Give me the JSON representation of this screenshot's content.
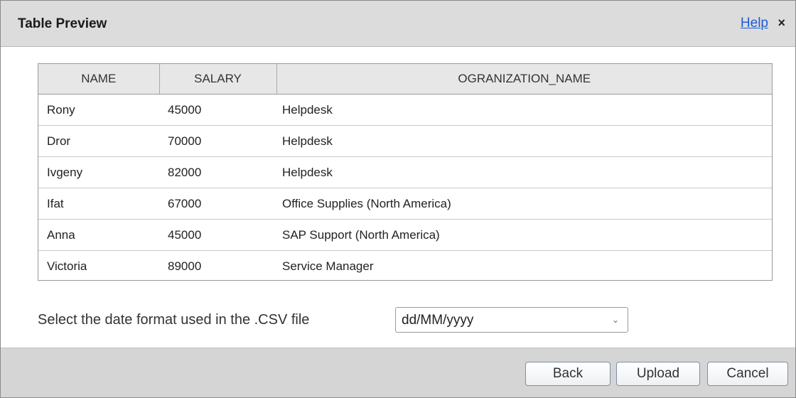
{
  "dialog": {
    "title": "Table Preview",
    "help_label": "Help",
    "close_glyph": "×"
  },
  "table": {
    "columns": [
      "NAME",
      "SALARY",
      "OGRANIZATION_NAME"
    ],
    "rows": [
      [
        "Rony",
        "45000",
        "Helpdesk"
      ],
      [
        "Dror",
        "70000",
        "Helpdesk"
      ],
      [
        "Ivgeny",
        "82000",
        "Helpdesk"
      ],
      [
        "Ifat",
        "67000",
        "Office Supplies (North America)"
      ],
      [
        "Anna",
        "45000",
        "SAP Support (North America)"
      ],
      [
        "Victoria",
        "89000",
        "Service Manager"
      ]
    ]
  },
  "date_format": {
    "label": "Select the date format used in the .CSV file",
    "selected": "dd/MM/yyyy"
  },
  "footer": {
    "back_label": "Back",
    "upload_label": "Upload",
    "cancel_label": "Cancel"
  }
}
